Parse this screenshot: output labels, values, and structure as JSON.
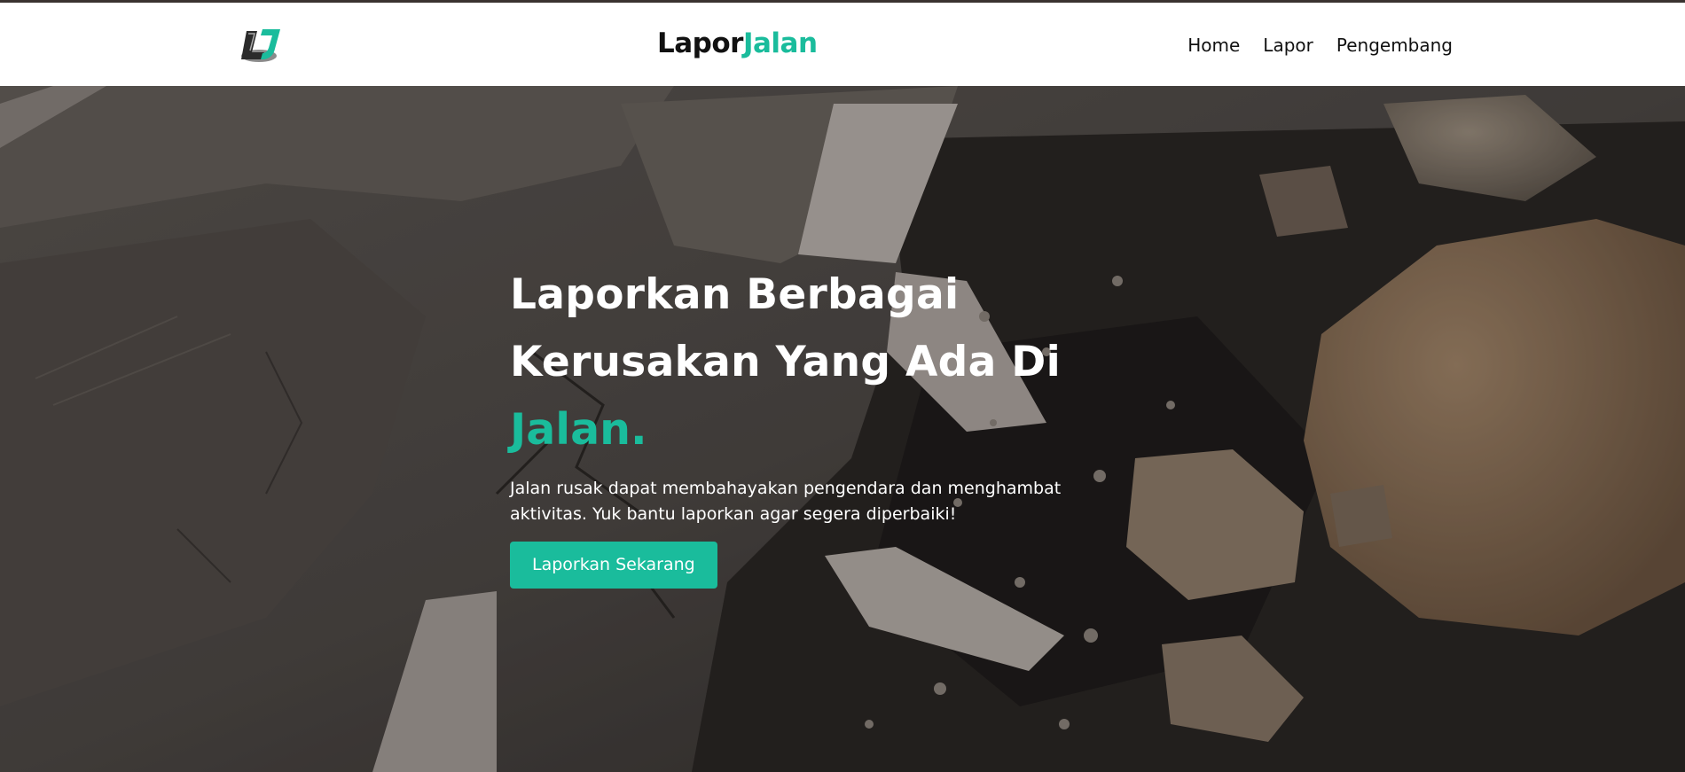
{
  "brand": {
    "part1": "Lapor",
    "part2": "Jalan"
  },
  "nav": {
    "items": [
      "Home",
      "Lapor",
      "Pengembang"
    ]
  },
  "hero": {
    "title_line1": "Laporkan Berbagai",
    "title_line2": "Kerusakan Yang Ada Di",
    "title_accent": "Jalan.",
    "description": "Jalan rusak dapat membahayakan pengendara dan menghambat aktivitas. Yuk bantu laporkan agar segera diperbaiki!",
    "cta_label": "Laporkan Sekarang"
  },
  "colors": {
    "accent": "#1abc9c",
    "text_dark": "#111111"
  },
  "icons": {
    "logo": "laporjalan-logo",
    "background": "damaged-road-photo"
  }
}
